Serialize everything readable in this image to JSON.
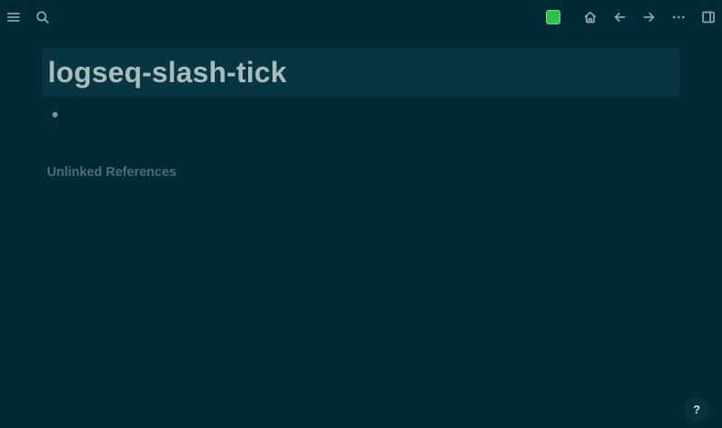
{
  "topbar": {
    "left_icons": [
      "menu-icon",
      "search-icon"
    ],
    "right_icons": [
      "sync-status-icon",
      "home-icon",
      "back-arrow-icon",
      "forward-arrow-icon",
      "more-icon",
      "sidebar-toggle-icon"
    ],
    "sync_color": "#2fbf4f"
  },
  "page": {
    "title": "logseq-slash-tick",
    "blocks": [
      ""
    ],
    "unlinked_references_label": "Unlinked References"
  },
  "help": {
    "label": "?"
  },
  "colors": {
    "background": "#002b36",
    "title_background": "#073642",
    "title_text": "#a9bcbc",
    "muted_text": "#4f6d73"
  }
}
